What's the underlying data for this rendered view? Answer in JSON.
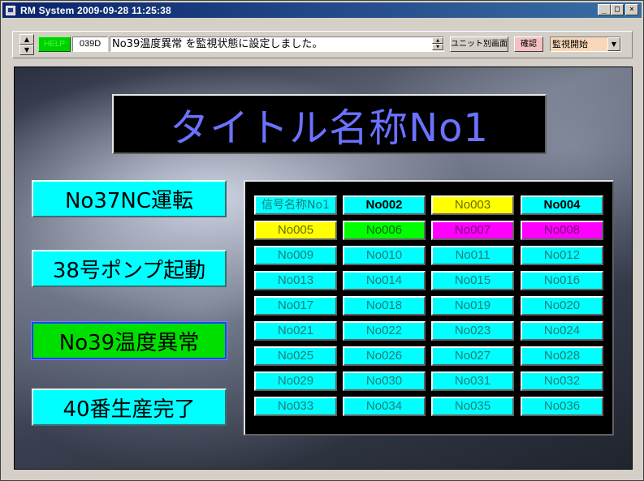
{
  "window": {
    "title": "RM System   2009-09-28 11:25:38",
    "minimize": "_",
    "maximize": "□",
    "close": "×"
  },
  "toolbar": {
    "spin_up": "▲",
    "spin_down": "▼",
    "help_label": "HELP",
    "code": "039D",
    "message": "No39温度異常 を監視状態に設定しました。",
    "unit_button": "ユニット別画面",
    "confirm_button": "確認",
    "mode_select": "監視開始",
    "mode_arrow": "▼"
  },
  "title_panel": {
    "title": "タイトル名称No1"
  },
  "side_buttons": [
    {
      "label": "No37NC運転",
      "active": false
    },
    {
      "label": "38号ポンプ起動",
      "active": false
    },
    {
      "label": "No39温度異常",
      "active": true
    },
    {
      "label": "40番生産完了",
      "active": false
    }
  ],
  "grid": {
    "cells": [
      {
        "label": "信号名称No1",
        "color": "cyan",
        "style": "head"
      },
      {
        "label": "No002",
        "color": "cyan",
        "style": "bold"
      },
      {
        "label": "No003",
        "color": "yellow",
        "style": ""
      },
      {
        "label": "No004",
        "color": "cyan",
        "style": "bold"
      },
      {
        "label": "No005",
        "color": "yellow",
        "style": ""
      },
      {
        "label": "No006",
        "color": "green",
        "style": ""
      },
      {
        "label": "No007",
        "color": "magenta",
        "style": ""
      },
      {
        "label": "No008",
        "color": "magenta",
        "style": ""
      },
      {
        "label": "No009",
        "color": "cyan",
        "style": ""
      },
      {
        "label": "No010",
        "color": "cyan",
        "style": ""
      },
      {
        "label": "No011",
        "color": "cyan",
        "style": ""
      },
      {
        "label": "No012",
        "color": "cyan",
        "style": ""
      },
      {
        "label": "No013",
        "color": "cyan",
        "style": ""
      },
      {
        "label": "No014",
        "color": "cyan",
        "style": ""
      },
      {
        "label": "No015",
        "color": "cyan",
        "style": ""
      },
      {
        "label": "No016",
        "color": "cyan",
        "style": ""
      },
      {
        "label": "No017",
        "color": "cyan",
        "style": ""
      },
      {
        "label": "No018",
        "color": "cyan",
        "style": ""
      },
      {
        "label": "No019",
        "color": "cyan",
        "style": ""
      },
      {
        "label": "No020",
        "color": "cyan",
        "style": ""
      },
      {
        "label": "No021",
        "color": "cyan",
        "style": ""
      },
      {
        "label": "No022",
        "color": "cyan",
        "style": ""
      },
      {
        "label": "No023",
        "color": "cyan",
        "style": ""
      },
      {
        "label": "No024",
        "color": "cyan",
        "style": ""
      },
      {
        "label": "No025",
        "color": "cyan",
        "style": ""
      },
      {
        "label": "No026",
        "color": "cyan",
        "style": ""
      },
      {
        "label": "No027",
        "color": "cyan",
        "style": ""
      },
      {
        "label": "No028",
        "color": "cyan",
        "style": ""
      },
      {
        "label": "No029",
        "color": "cyan",
        "style": ""
      },
      {
        "label": "No030",
        "color": "cyan",
        "style": ""
      },
      {
        "label": "No031",
        "color": "cyan",
        "style": ""
      },
      {
        "label": "No032",
        "color": "cyan",
        "style": ""
      },
      {
        "label": "No033",
        "color": "cyan",
        "style": ""
      },
      {
        "label": "No034",
        "color": "cyan",
        "style": ""
      },
      {
        "label": "No035",
        "color": "cyan",
        "style": ""
      },
      {
        "label": "No036",
        "color": "cyan",
        "style": ""
      }
    ]
  }
}
